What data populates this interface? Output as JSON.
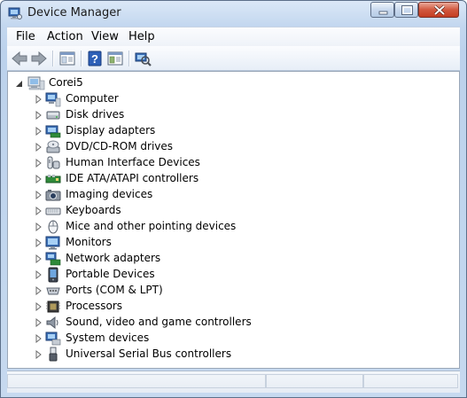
{
  "window": {
    "title": "Device Manager"
  },
  "menu": [
    "File",
    "Action",
    "View",
    "Help"
  ],
  "toolbar_icons": [
    "back-arrow-icon",
    "forward-arrow-icon",
    "show-hide-console-tree-icon",
    "help-icon",
    "properties-icon",
    "scan-hardware-icon"
  ],
  "tree": {
    "root": "Corei5",
    "categories": [
      {
        "label": "Computer",
        "icon": "computer-icon"
      },
      {
        "label": "Disk drives",
        "icon": "disk-drive-icon"
      },
      {
        "label": "Display adapters",
        "icon": "display-adapter-icon"
      },
      {
        "label": "DVD/CD-ROM drives",
        "icon": "dvd-drive-icon"
      },
      {
        "label": "Human Interface Devices",
        "icon": "hid-icon"
      },
      {
        "label": "IDE ATA/ATAPI controllers",
        "icon": "ide-controller-icon"
      },
      {
        "label": "Imaging devices",
        "icon": "imaging-device-icon"
      },
      {
        "label": "Keyboards",
        "icon": "keyboard-icon"
      },
      {
        "label": "Mice and other pointing devices",
        "icon": "mouse-icon"
      },
      {
        "label": "Monitors",
        "icon": "monitor-icon"
      },
      {
        "label": "Network adapters",
        "icon": "network-adapter-icon"
      },
      {
        "label": "Portable Devices",
        "icon": "portable-device-icon"
      },
      {
        "label": "Ports (COM & LPT)",
        "icon": "port-icon"
      },
      {
        "label": "Processors",
        "icon": "processor-icon"
      },
      {
        "label": "Sound, video and game controllers",
        "icon": "sound-icon"
      },
      {
        "label": "System devices",
        "icon": "system-device-icon"
      },
      {
        "label": "Universal Serial Bus controllers",
        "icon": "usb-icon"
      }
    ]
  },
  "colors": {
    "title_bar": "#c3d7ef",
    "close_button": "#c33d22",
    "tree_expander": "#6a6a6a"
  }
}
